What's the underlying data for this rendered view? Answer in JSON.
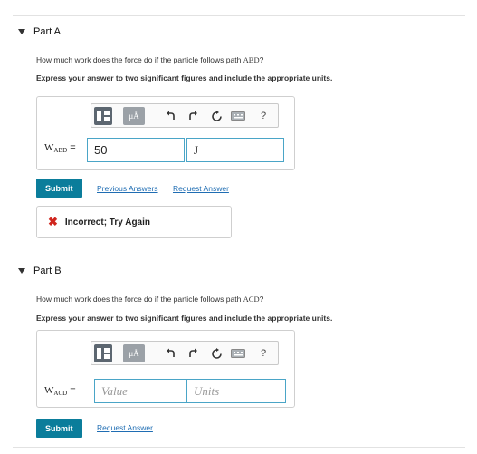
{
  "parts": [
    {
      "title": "Part A",
      "question_prefix": "How much work does the force do if the particle follows path ",
      "path": "ABD",
      "question_suffix": "?",
      "instruction": "Express your answer to two significant figures and include the appropriate units.",
      "var_symbol": "W",
      "var_sub": "ABD",
      "equals": "=",
      "value": "50",
      "units": "J",
      "submit_label": "Submit",
      "prev_answers_label": "Previous Answers",
      "request_answer_label": "Request Answer",
      "feedback_text": "Incorrect; Try Again"
    },
    {
      "title": "Part B",
      "question_prefix": "How much work does the force do if the particle follows path ",
      "path": "ACD",
      "question_suffix": "?",
      "instruction": "Express your answer to two significant figures and include the appropriate units.",
      "var_symbol": "W",
      "var_sub": "ACD",
      "equals": "=",
      "value_placeholder": "Value",
      "units_placeholder": "Units",
      "submit_label": "Submit",
      "request_answer_label": "Request Answer"
    }
  ],
  "toolbar": {
    "mu_label": "μÅ",
    "help_label": "?"
  },
  "feedback_mark": "✖",
  "colors": {
    "submit_bg": "#0b7d9b",
    "link": "#1f6db3",
    "input_border": "#4aa5c7",
    "error": "#d0261e"
  }
}
